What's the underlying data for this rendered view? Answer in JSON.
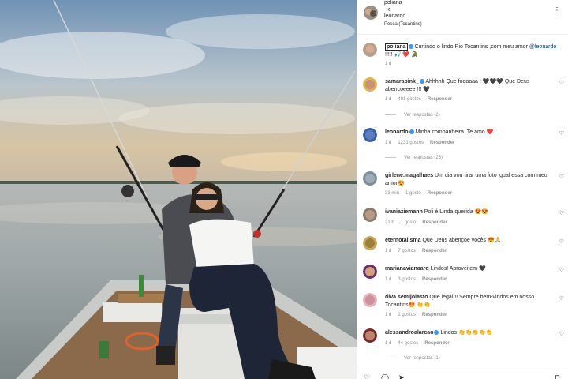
{
  "post": {
    "author_1": "poliana",
    "connector": "e",
    "author_2": "leonardo",
    "location": "Pesca (Tocantins)",
    "more_icon": "⋮"
  },
  "caption": {
    "username": "poliana",
    "text": "Curtindo o lindo Rio Tocantins ,com meu amor",
    "mention": "@leonardo",
    "text_end": " !!!!! 🎣 ❤️ 🐊",
    "time": "1 d"
  },
  "comments": [
    {
      "username": "samarapink_",
      "verified": true,
      "text": " Ahhhhh Que fodaaaa ! 🖤🖤🖤 Que Deus abencoeeee !!! 🖤",
      "time": "1 d",
      "likes": "491 gostos",
      "reply": "Responder",
      "replies": "Ver respostas (2)"
    },
    {
      "username": "leonardo",
      "verified": true,
      "text": " Minha companheira. Te amo ❤️",
      "time": "1 d",
      "likes": "1231 gostos",
      "reply": "Responder",
      "replies": "Ver respostas (26)"
    },
    {
      "username": "girlene.magalhaes",
      "verified": false,
      "text": " Um dia vou tirar uma foto igual essa com meu amor😍",
      "time": "33 min",
      "likes": "1 gosto",
      "reply": "Responder",
      "replies": ""
    },
    {
      "username": "ivaniaziemann",
      "verified": false,
      "text": " Poli é Linda querida 😍😍",
      "time": "21 h",
      "likes": "1 gosto",
      "reply": "Responder",
      "replies": ""
    },
    {
      "username": "eternotalisma",
      "verified": false,
      "text": " Que Deus abençoe vocês 😍🙏",
      "time": "1 d",
      "likes": "7 gostos",
      "reply": "Responder",
      "replies": ""
    },
    {
      "username": "marianavianaarq",
      "verified": false,
      "text": " Lindos! Aproveitem 🖤",
      "time": "1 d",
      "likes": "3 gostos",
      "reply": "Responder",
      "replies": ""
    },
    {
      "username": "diva.semijoiasto",
      "verified": false,
      "text": " Que legal!!! Sempre bem-vindos em nosso Tocantins😍 👏👏",
      "time": "1 d",
      "likes": "2 gostos",
      "reply": "Responder",
      "replies": ""
    },
    {
      "username": "alessandroalarcao",
      "verified": true,
      "text": " Lindos 👏👏👏👏👏",
      "time": "1 d",
      "likes": "44 gostos",
      "reply": "Responder",
      "replies": "Ver respostas (1)"
    }
  ],
  "icons": {
    "heart": "♡",
    "like_action": "♡",
    "comment_action": "◯",
    "share_action": "➤",
    "save_action": "⊓"
  },
  "colors": {
    "link": "#00376b",
    "muted": "#8e8e8e",
    "verified": "#3897f0"
  }
}
